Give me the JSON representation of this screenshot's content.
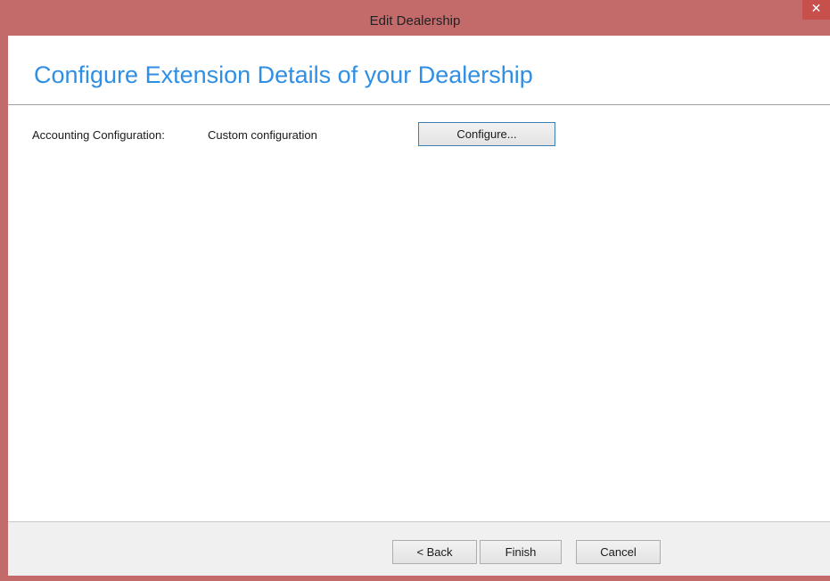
{
  "window": {
    "title": "Edit Dealership",
    "close_glyph": "✕"
  },
  "header": {
    "title": "Configure Extension Details of your Dealership"
  },
  "form": {
    "accounting_label": "Accounting Configuration:",
    "accounting_value": "Custom configuration",
    "configure_button": "Configure..."
  },
  "footer": {
    "back_button": "< Back",
    "finish_button": "Finish",
    "cancel_button": "Cancel"
  },
  "colors": {
    "titlebar": "#c26b6a",
    "title_accent": "#2f8fe5",
    "close_button": "#c7504d"
  }
}
